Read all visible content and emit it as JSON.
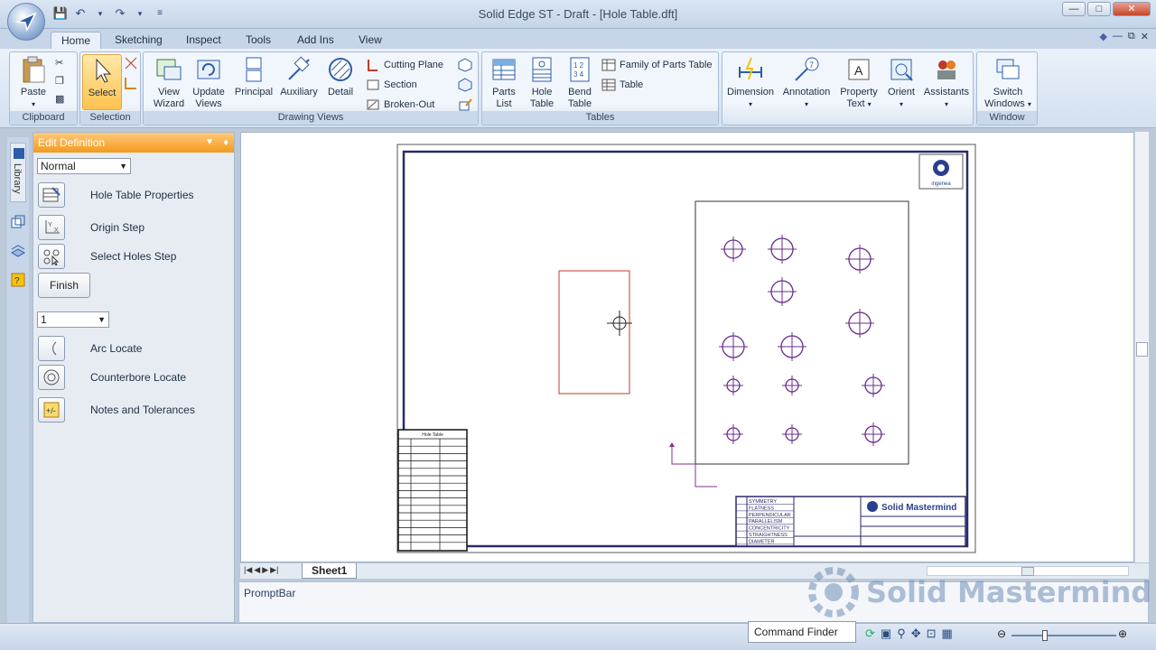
{
  "window": {
    "title": "Solid Edge ST - Draft - [Hole Table.dft]"
  },
  "tabs": [
    "Home",
    "Sketching",
    "Inspect",
    "Tools",
    "Add Ins",
    "View"
  ],
  "ribbon": {
    "clipboard": {
      "label": "Clipboard",
      "paste": "Paste"
    },
    "selection": {
      "label": "Selection",
      "select": "Select"
    },
    "drawing_views": {
      "label": "Drawing Views",
      "view_wizard": "View Wizard",
      "update_views": "Update Views",
      "principal": "Principal",
      "auxiliary": "Auxiliary",
      "detail": "Detail",
      "cutting_plane": "Cutting Plane",
      "section": "Section",
      "broken_out": "Broken-Out"
    },
    "tables": {
      "label": "Tables",
      "parts_list": "Parts List",
      "hole_table": "Hole Table",
      "bend_table": "Bend Table",
      "family_parts": "Family of Parts Table",
      "table": "Table"
    },
    "dimension": "Dimension",
    "annotation": "Annotation",
    "property_text": "Property Text",
    "orient": "Orient",
    "assistants": "Assistants",
    "window": {
      "label": "Window",
      "switch_windows": "Switch Windows"
    }
  },
  "side_tab": "Library",
  "edit_definition": {
    "title": "Edit Definition",
    "mode": "Normal",
    "hole_table_properties": "Hole Table Properties",
    "origin_step": "Origin Step",
    "select_holes_step": "Select Holes Step",
    "finish": "Finish",
    "count": "1",
    "arc_locate": "Arc Locate",
    "counterbore_locate": "Counterbore Locate",
    "notes_tolerances": "Notes and Tolerances"
  },
  "drawing": {
    "logo_text": "ingenea",
    "titleblock_brand": "Solid Mastermind",
    "gdt": [
      "SYMMETRY",
      "FLATNESS",
      "PERPENDICULAR",
      "PARALLELISM",
      "CONCENTRICITY",
      "STRAIGHTNESS",
      "DIAMETER"
    ],
    "hole_table_title": "Hole Table"
  },
  "sheet_tab": "Sheet1",
  "promptbar": "PromptBar",
  "command_finder": "Command Finder",
  "watermark": "Solid Mastermind",
  "colors": {
    "accent": "#f39b1d",
    "hole": "#6a2c8e",
    "selection_box": "#c0392b"
  }
}
